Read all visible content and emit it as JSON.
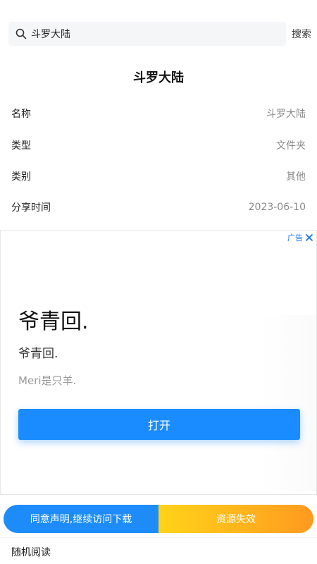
{
  "search": {
    "query": "斗罗大陆",
    "button_label": "搜索"
  },
  "page_title": "斗罗大陆",
  "info": [
    {
      "key": "名称",
      "value": "斗罗大陆"
    },
    {
      "key": "类型",
      "value": "文件夹"
    },
    {
      "key": "类别",
      "value": "其他"
    },
    {
      "key": "分享时间",
      "value": "2023-06-10"
    }
  ],
  "ad": {
    "badge": "广告",
    "headline": "爷青回.",
    "subheadline": "爷青回.",
    "description": "Meri是只羊.",
    "open_button": "打开",
    "accent_color": "#1a8cff"
  },
  "actions": {
    "agree_label": "同意声明,继续访问下载",
    "invalid_label": "资源失效",
    "agree_color": "#1d8cf8",
    "invalid_color": "#ff9a1f"
  },
  "random_read": "随机阅读"
}
